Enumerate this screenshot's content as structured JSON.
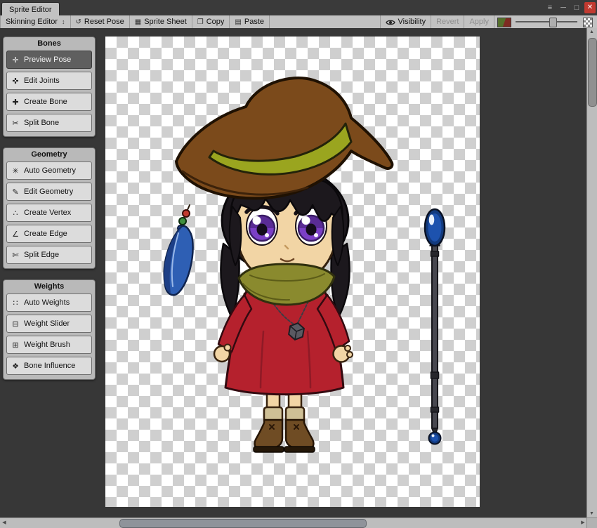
{
  "window": {
    "tab_title": "Sprite Editor",
    "controls": {
      "menu": "≡",
      "minimize": "─",
      "maximize": "□",
      "close": "✕"
    }
  },
  "toolbar": {
    "mode_label": "Skinning Editor",
    "mode_caret": "↕",
    "reset_pose": {
      "glyph": "↺",
      "label": "Reset Pose"
    },
    "sprite_sheet": {
      "glyph": "▦",
      "label": "Sprite Sheet"
    },
    "copy": {
      "glyph": "❐",
      "label": "Copy"
    },
    "paste": {
      "glyph": "▤",
      "label": "Paste"
    },
    "visibility_label": "Visibility",
    "revert_label": "Revert",
    "apply_label": "Apply"
  },
  "panels": {
    "bones": {
      "title": "Bones",
      "buttons": [
        {
          "glyph": "✛",
          "label": "Preview Pose"
        },
        {
          "glyph": "✜",
          "label": "Edit Joints"
        },
        {
          "glyph": "✚",
          "label": "Create Bone"
        },
        {
          "glyph": "✂",
          "label": "Split Bone"
        }
      ]
    },
    "geometry": {
      "title": "Geometry",
      "buttons": [
        {
          "glyph": "✳",
          "label": "Auto Geometry"
        },
        {
          "glyph": "✎",
          "label": "Edit Geometry"
        },
        {
          "glyph": "∴",
          "label": "Create Vertex"
        },
        {
          "glyph": "∠",
          "label": "Create Edge"
        },
        {
          "glyph": "✄",
          "label": "Split Edge"
        }
      ]
    },
    "weights": {
      "title": "Weights",
      "buttons": [
        {
          "glyph": "∷",
          "label": "Auto Weights"
        },
        {
          "glyph": "⊟",
          "label": "Weight Slider"
        },
        {
          "glyph": "⊞",
          "label": "Weight Brush"
        },
        {
          "glyph": "❖",
          "label": "Bone Influence"
        }
      ]
    }
  },
  "scrollbars": {
    "up": "▲",
    "down": "▼",
    "left": "◀",
    "right": "▶"
  },
  "colors": {
    "canvas_bg": "#373737",
    "toolbar_bg": "#c2c2c2",
    "selected_button_bg": "#5f5f5f",
    "close_button_red": "#c23a30",
    "checker_light": "#ffffff",
    "checker_dark": "#cfcfcf"
  }
}
